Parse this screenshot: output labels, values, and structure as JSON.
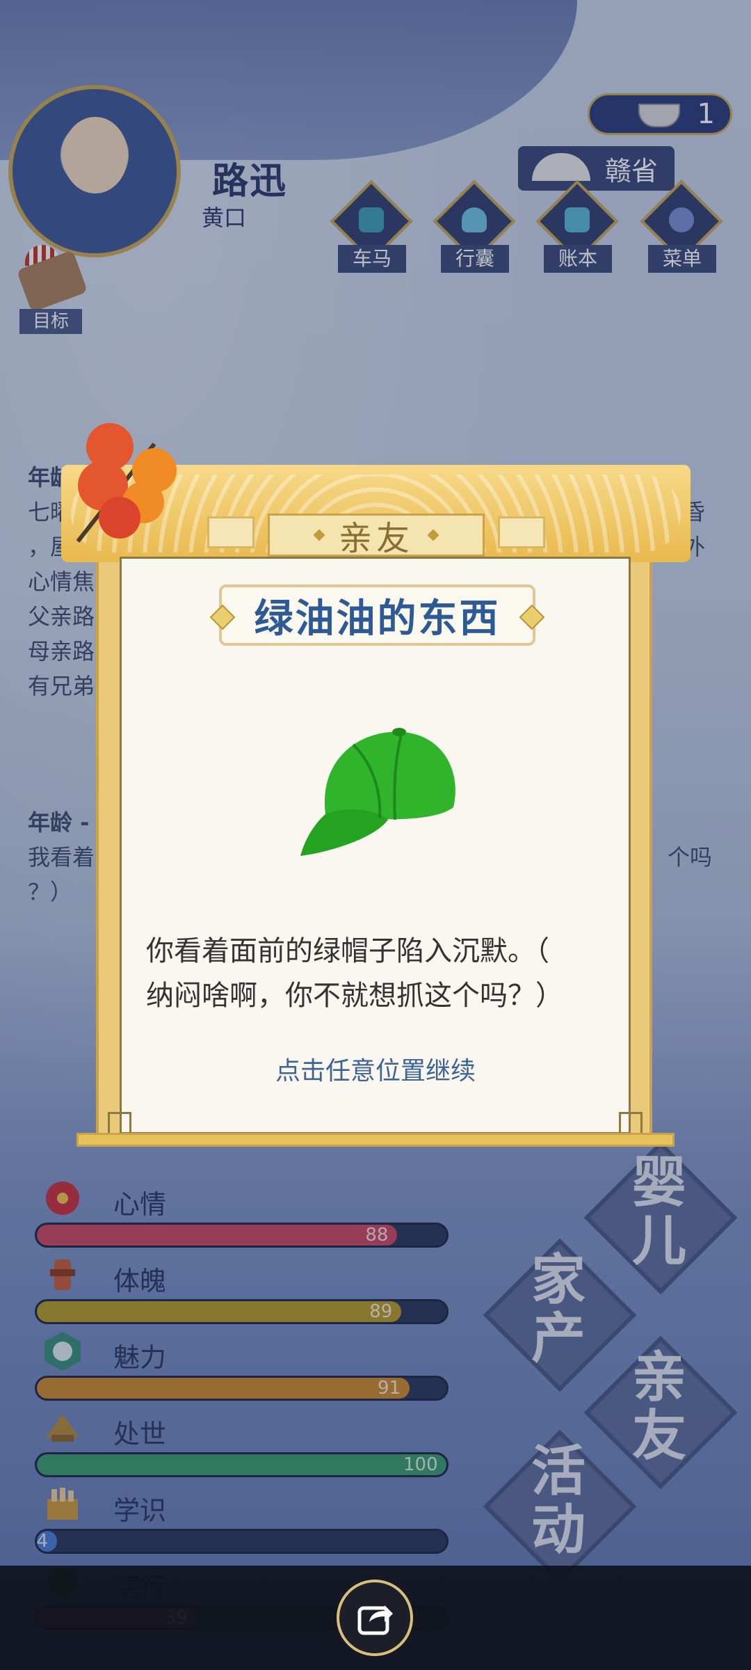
{
  "player": {
    "name": "路迅",
    "subtitle": "黄口"
  },
  "currency": {
    "amount": "1"
  },
  "province": {
    "label": "赣省"
  },
  "top_menu": [
    {
      "label": "车马",
      "icon": "carriage-icon"
    },
    {
      "label": "行囊",
      "icon": "bag-icon"
    },
    {
      "label": "账本",
      "icon": "ledger-icon"
    },
    {
      "label": "菜单",
      "icon": "menu-dots-icon"
    }
  ],
  "goal": {
    "label": "目标"
  },
  "log": {
    "line1": "年龄",
    "line2_left": "七曜",
    "line2_right": "黄昏",
    "line3_left": "，屋",
    "line3_right": "屋外",
    "line4": "心情焦",
    "line5": "父亲路",
    "line6": "母亲路",
    "line7": "有兄弟",
    "line8": "年龄 -",
    "line9_left": "我看着",
    "line9_right": "个吗",
    "line10": "？）"
  },
  "modal": {
    "category": "亲友",
    "item_name": "绿油油的东西",
    "item_icon": "green-cap-icon",
    "text_line1": "你看着面前的绿帽子陷入沉默。（",
    "text_line2": "纳闷啥啊，你不就想抓这个吗？）",
    "continue": "点击任意位置继续"
  },
  "stats": [
    {
      "label": "心情",
      "value": 88,
      "display": "88",
      "color": "#c94a63"
    },
    {
      "label": "体魄",
      "value": 89,
      "display": "89",
      "color": "#b49a2a"
    },
    {
      "label": "魅力",
      "value": 91,
      "display": "91",
      "color": "#c98a2e"
    },
    {
      "label": "处世",
      "value": 100,
      "display": "100",
      "color": "#3e9a6e"
    },
    {
      "label": "学识",
      "value": 4,
      "display": "4",
      "color": "#4a7fd0"
    },
    {
      "label": "德行",
      "value": 39,
      "display": "39",
      "color": "#9c3b7a"
    }
  ],
  "tabs": [
    {
      "label": "婴儿"
    },
    {
      "label": "家产"
    },
    {
      "label": "亲友"
    },
    {
      "label": "活动"
    }
  ]
}
